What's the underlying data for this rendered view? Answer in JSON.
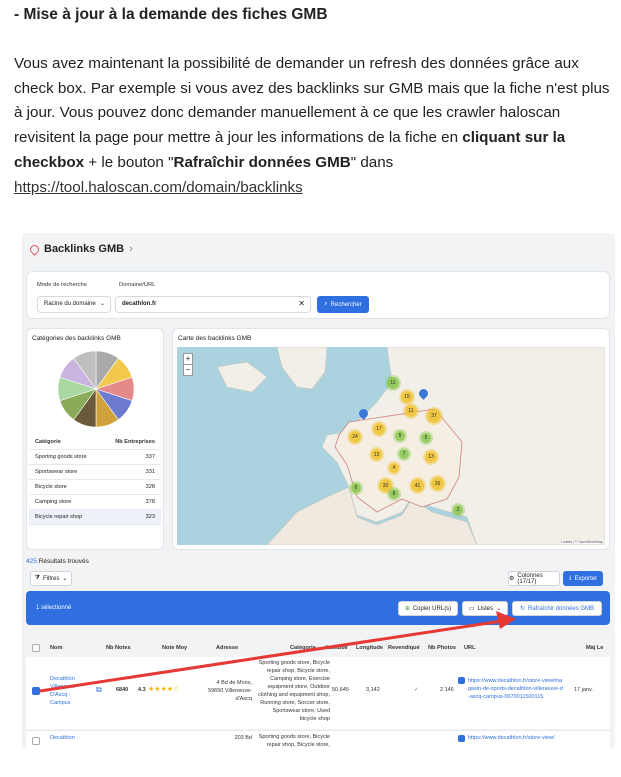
{
  "article": {
    "heading": "- Mise à jour à la demande des fiches GMB",
    "p1": "Vous avez maintenant la possibilité de demander un refresh des données grâce aux check box.  Par exemple si vous avez des backlinks sur GMB mais que la fiche n'est plus à jour. Vous pouvez donc demander manuellement à ce que les crawler haloscan revisitent la page pour mettre à jour les informations de la fiche en ",
    "bold1": "cliquant sur la checkbox",
    "p2": " + le bouton \"",
    "bold2": "Rafraîchir données GMB",
    "p3": "\" dans",
    "link": "https://tool.haloscan.com/domain/backlinks"
  },
  "app": {
    "breadcrumb": "Backlinks GMB",
    "search": {
      "mode_label": "Mode de recherche",
      "mode_value": "Racine du domaine",
      "domain_label": "Domaine/URL",
      "domain_value": "decathlon.fr",
      "search_button": "Rechercher"
    },
    "categories": {
      "title": "Catégories des backlinks GMB",
      "col1": "Catégorie",
      "col2": "Nb Entreprises",
      "rows": [
        {
          "name": "Sporting goods store",
          "count": "337"
        },
        {
          "name": "Sportswear store",
          "count": "331"
        },
        {
          "name": "Bicycle store",
          "count": "328"
        },
        {
          "name": "Camping store",
          "count": "378"
        },
        {
          "name": "Bicycle repair shop",
          "count": "323"
        }
      ],
      "pie_colors": [
        "#aaaaaa",
        "#f2c94c",
        "#e58a8a",
        "#6c7bd0",
        "#cfa33a",
        "#6b5a3a",
        "#8aab5a",
        "#a9d8a0",
        "#c9b4e0",
        "#bfbfbf"
      ]
    },
    "map": {
      "title": "Carte des backlinks GMB",
      "zoom_in": "+",
      "zoom_out": "−",
      "attribution": "Leaflet | © OpenStreetMap",
      "clusters": [
        "11",
        "15",
        "37",
        "11",
        "24",
        "17",
        "5",
        "13",
        "7",
        "5",
        "13",
        "4",
        "30",
        "41",
        "6",
        "26",
        "8",
        "2"
      ]
    },
    "results": {
      "count": "425",
      "label": "Résultats trouvés",
      "filters": "Filtres",
      "columns": "Colonnes (17/17)",
      "export": "Exporter"
    },
    "selection": {
      "selected": "1 sélectionné",
      "copy": "Copier URL(s)",
      "lists": "Listes",
      "refresh": "Rafraîchir données GMB"
    },
    "table": {
      "headers": [
        "Nom",
        "Nb Notes",
        "Note Moy",
        "Adresse",
        "Catégorie",
        "Latitude",
        "Longitude",
        "Revendiqué",
        "Nb Photos",
        "URL",
        "Màj Le"
      ],
      "rows": [
        {
          "name": "Decathlon Villeneuve D'Ascq - Campus",
          "notes": "6840",
          "avg": "4.3",
          "stars": "★★★★☆",
          "address": "4 Bd de Mons, 59650 Villeneuve-d'Ascq",
          "category": "Sporting goods store, Bicycle repair shop, Bicycle store, Camping store, Exercise equipment store, Outdoor clothing and equipment shop, Running store, Soccer store, Sportswear store, Used bicycle shop",
          "lat": "50,645",
          "lng": "3,142",
          "claimed": "✓",
          "photos": "2 146",
          "url": "https://www.decathlon.fr/store-view/magasin-de-sports-decathlon-villeneuve-d-ascq-campus-0070011500115",
          "updated": "17 janv."
        },
        {
          "name": "Decathlon",
          "address": "203 Bd",
          "category": "Sporting goods store, Bicycle repair shop, Bicycle store, Camping store, Outdoor",
          "url": "https://www.decathlon.fr/store-view/"
        }
      ]
    }
  }
}
